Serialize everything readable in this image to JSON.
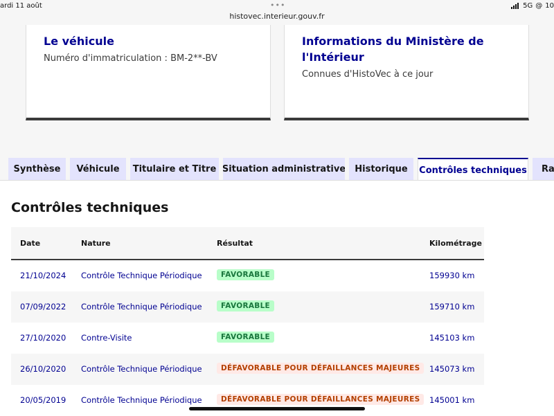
{
  "statusbar": {
    "date": "ardi 11 août",
    "url": "histovec.interieur.gouv.fr",
    "network": "5G",
    "battery": "10"
  },
  "cards": {
    "vehicle": {
      "title": "Le véhicule",
      "text": "Numéro d'immatriculation : BM-2**-BV"
    },
    "ministry": {
      "title": "Informations du Ministère de l'Intérieur",
      "text": "Connues d'HistoVec à ce jour"
    }
  },
  "tabs": [
    {
      "label": "Synthèse",
      "active": false
    },
    {
      "label": "Véhicule",
      "active": false
    },
    {
      "label": "Titulaire et Titre",
      "active": false
    },
    {
      "label": "Situation administrative",
      "active": false
    },
    {
      "label": "Historique",
      "active": false
    },
    {
      "label": "Contrôles techniques",
      "active": true
    },
    {
      "label": "Ra",
      "active": false
    }
  ],
  "section_title": "Contrôles techniques",
  "table": {
    "headers": {
      "date": "Date",
      "nature": "Nature",
      "result": "Résultat",
      "km": "Kilométrage"
    },
    "rows": [
      {
        "date": "21/10/2024",
        "nature": "Contrôle Technique Périodique",
        "result": "FAVORABLE",
        "status": "ok",
        "km": "159930 km"
      },
      {
        "date": "07/09/2022",
        "nature": "Contrôle Technique Périodique",
        "result": "FAVORABLE",
        "status": "ok",
        "km": "159710 km"
      },
      {
        "date": "27/10/2020",
        "nature": "Contre-Visite",
        "result": "FAVORABLE",
        "status": "ok",
        "km": "145103 km"
      },
      {
        "date": "26/10/2020",
        "nature": "Contrôle Technique Périodique",
        "result": "DÉFAVORABLE POUR DÉFAILLANCES MAJEURES",
        "status": "ko",
        "km": "145073 km"
      },
      {
        "date": "20/05/2019",
        "nature": "Contrôle Technique Périodique",
        "result": "DÉFAVORABLE POUR DÉFAILLANCES MAJEURES",
        "status": "ko",
        "km": "145001 km"
      }
    ]
  },
  "colors": {
    "accent": "#000091",
    "tab_bg": "#e3e3fd",
    "ok_bg": "#b8fec9",
    "ok_text": "#18753c",
    "ko_bg": "#ffe9e6",
    "ko_text": "#b34000"
  }
}
